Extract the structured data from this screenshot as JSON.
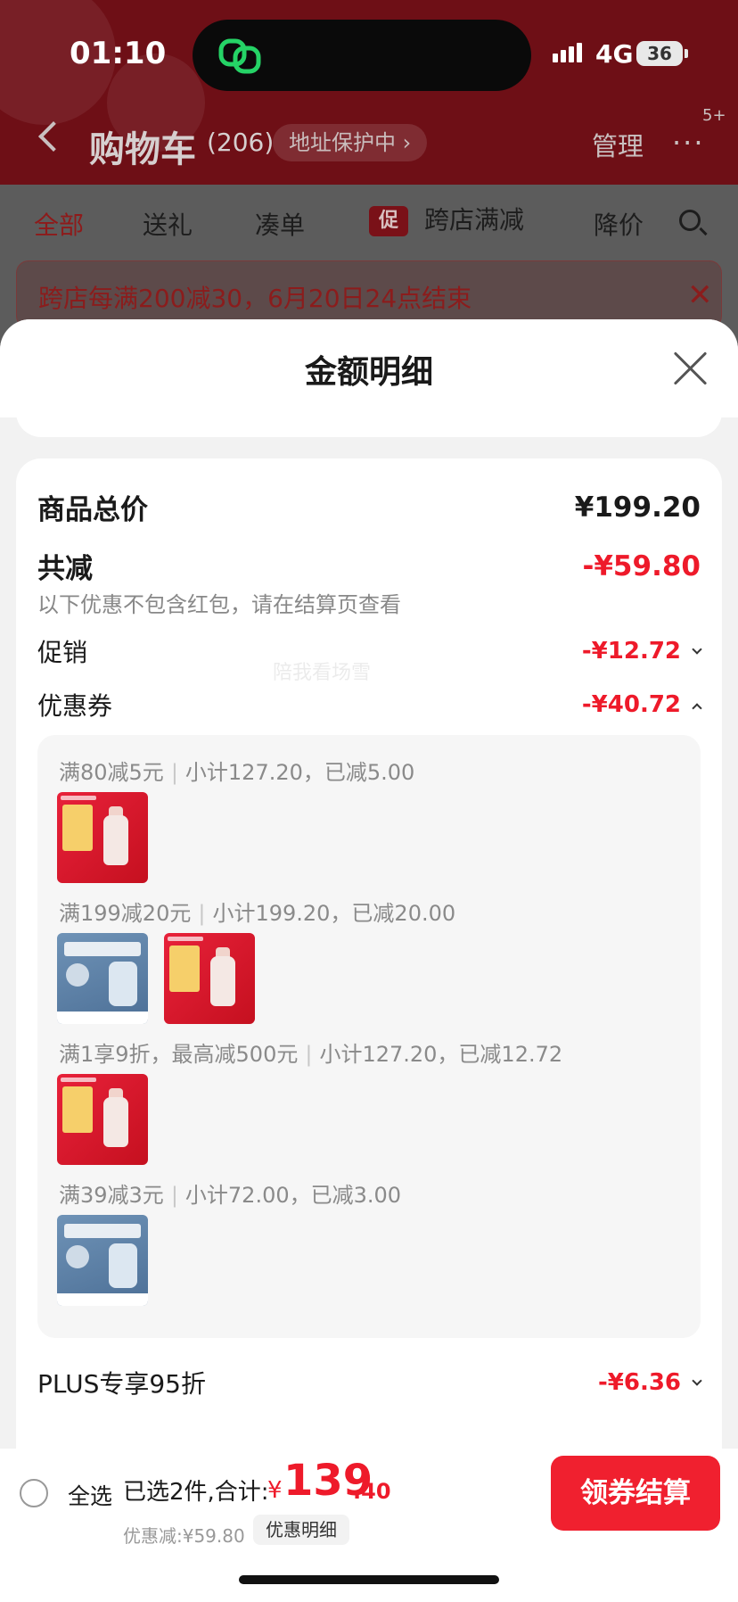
{
  "status_bar": {
    "time": "01:10",
    "network": "4G",
    "battery": "36"
  },
  "header": {
    "title": "购物车",
    "count": "(206)",
    "address_pill": "地址保护中 ›",
    "manage": "管理",
    "more_badge": "5+"
  },
  "tabs": [
    {
      "label": "全部"
    },
    {
      "label": "送礼"
    },
    {
      "label": "凑单"
    },
    {
      "label": "跨店满减",
      "icon": "促"
    },
    {
      "label": "降价"
    }
  ],
  "notice": "跨店每满200减30，6月20日24点结束",
  "sheet": {
    "title": "金额明细",
    "total_label": "商品总价",
    "total_value": "¥199.20",
    "reduce_label": "共减",
    "reduce_value": "-¥59.80",
    "reduce_note": "以下优惠不包含红包，请在结算页查看",
    "promo_label": "促销",
    "promo_value": "-¥12.72",
    "coupon_label": "优惠券",
    "coupon_value": "-¥40.72",
    "watermark": "陪我看场雪",
    "coupons": [
      {
        "rule": "满80减5元",
        "detail": "小计127.20，已减5.00"
      },
      {
        "rule": "满199减20元",
        "detail": "小计199.20，已减20.00"
      },
      {
        "rule": "满1享9折，最高减500元",
        "detail": "小计127.20，已减12.72"
      },
      {
        "rule": "满39减3元",
        "detail": "小计72.00，已减3.00"
      }
    ],
    "plus_label": "PLUS专享95折",
    "plus_value": "-¥6.36"
  },
  "bottom_bar": {
    "select_all": "全选",
    "selected_text": "已选2件,合计:",
    "currency": "¥",
    "amount_int": "139",
    "amount_dec": ".40",
    "discount_text": "优惠减:¥59.80",
    "detail_button": "优惠明细",
    "checkout_button": "领券结算"
  },
  "colors": {
    "accent_red": "#ee1a2a",
    "checkout_red": "#f0202f"
  }
}
